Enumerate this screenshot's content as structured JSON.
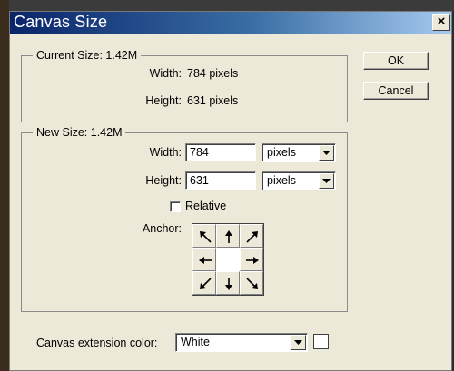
{
  "dialog": {
    "title": "Canvas Size",
    "close_label": "×"
  },
  "current_size": {
    "legend": "Current Size: 1.42M",
    "width_label": "Width:",
    "width_value": "784 pixels",
    "height_label": "Height:",
    "height_value": "631 pixels"
  },
  "new_size": {
    "legend": "New Size: 1.42M",
    "width_label": "Width:",
    "width_value": "784",
    "width_unit": "pixels",
    "height_label": "Height:",
    "height_value": "631",
    "height_unit": "pixels",
    "relative_label": "Relative",
    "relative_checked": false,
    "anchor_label": "Anchor:",
    "anchor_cells": [
      {
        "name": "top-left",
        "icon": "arrow-up-left-icon"
      },
      {
        "name": "top",
        "icon": "arrow-up-icon"
      },
      {
        "name": "top-right",
        "icon": "arrow-up-right-icon"
      },
      {
        "name": "left",
        "icon": "arrow-left-icon"
      },
      {
        "name": "center",
        "icon": ""
      },
      {
        "name": "right",
        "icon": "arrow-right-icon"
      },
      {
        "name": "bottom-left",
        "icon": "arrow-down-left-icon"
      },
      {
        "name": "bottom",
        "icon": "arrow-down-icon"
      },
      {
        "name": "bottom-right",
        "icon": "arrow-down-right-icon"
      }
    ],
    "anchor_selected": "center"
  },
  "extension": {
    "label": "Canvas extension color:",
    "value": "White",
    "swatch_color": "#FFFFFF"
  },
  "buttons": {
    "ok": "OK",
    "cancel": "Cancel"
  },
  "colors": {
    "titlebar_start": "#0A246A",
    "titlebar_end": "#A6CAF0",
    "dialog_bg": "#ECE9D8"
  }
}
